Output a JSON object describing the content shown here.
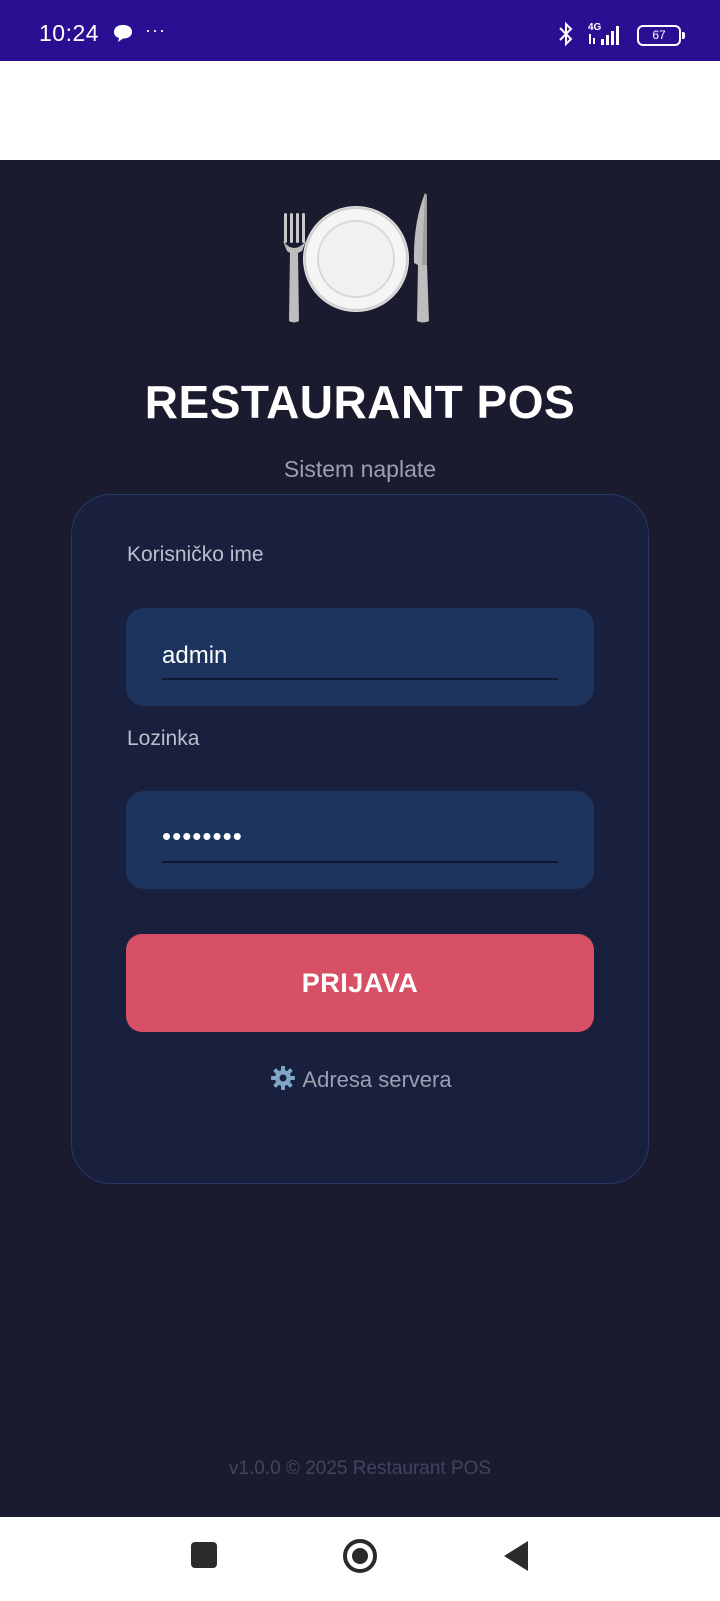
{
  "status_bar": {
    "time": "10:24",
    "more": "···",
    "network": "4G",
    "battery": "67"
  },
  "app": {
    "title": "RESTAURANT POS",
    "subtitle": "Sistem naplate",
    "logo_icon": "plate-fork-knife-icon"
  },
  "login": {
    "username_label": "Korisničko ime",
    "username_value": "admin",
    "password_label": "Lozinka",
    "password_value": "••••••••",
    "submit_label": "PRIJAVA",
    "server_link_label": "Adresa servera",
    "server_icon": "gear-icon"
  },
  "footer": {
    "text": "v1.0.0 © 2025 Restaurant POS"
  },
  "colors": {
    "status_bar": "#2a0f93",
    "background": "#1b1b2f",
    "card": "#18203d",
    "field": "#1c345e",
    "primary_button": "#d75066"
  }
}
